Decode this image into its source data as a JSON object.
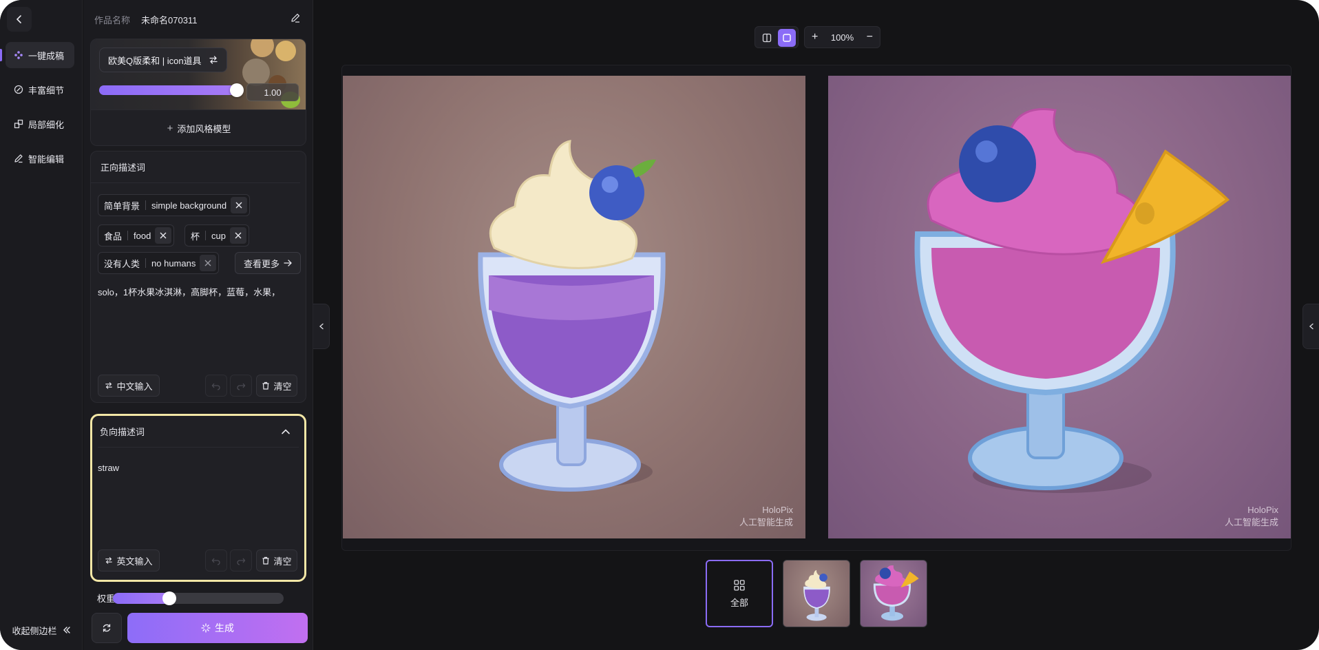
{
  "sidebar": {
    "items": [
      {
        "label": "一键成稿",
        "icon": "sparkle-dots-icon",
        "active": true
      },
      {
        "label": "丰富细节",
        "icon": "detail-icon",
        "active": false
      },
      {
        "label": "局部细化",
        "icon": "local-refine-icon",
        "active": false
      },
      {
        "label": "智能编辑",
        "icon": "pencil-icon",
        "active": false
      }
    ],
    "collapse_label": "收起侧边栏"
  },
  "work": {
    "name_label": "作品名称",
    "name_value": "未命名070311"
  },
  "style_model": {
    "name": "欧美Q版柔和 | icon道具",
    "strength": 1.0,
    "strength_text": "1.00",
    "add_label": "添加风格模型"
  },
  "positive_prompt": {
    "title": "正向描述词",
    "tags": [
      {
        "cn": "简单背景",
        "en": "simple background"
      },
      {
        "cn": "食品",
        "en": "food"
      },
      {
        "cn": "杯",
        "en": "cup"
      },
      {
        "cn": "没有人类",
        "en": "no humans"
      }
    ],
    "more_label": "查看更多",
    "text": "solo，1杯水果冰淇淋，高脚杯，蓝莓，水果，",
    "lang_button": "中文输入",
    "clear_label": "清空"
  },
  "negative_prompt": {
    "title": "负向描述词",
    "text": "straw",
    "lang_button": "英文输入",
    "clear_label": "清空"
  },
  "weight": {
    "label": "权重",
    "value": 0.33
  },
  "generate_label": "生成",
  "toolbar": {
    "zoom_text": "100%"
  },
  "images": [
    {
      "watermark_brand": "HoloPix",
      "watermark_note": "人工智能生成"
    },
    {
      "watermark_brand": "HoloPix",
      "watermark_note": "人工智能生成"
    }
  ],
  "thumbnails": {
    "all_label": "全部"
  },
  "colors": {
    "accent": "#8b6cf7",
    "highlight_border": "#f3e7a6",
    "background": "#141416"
  }
}
